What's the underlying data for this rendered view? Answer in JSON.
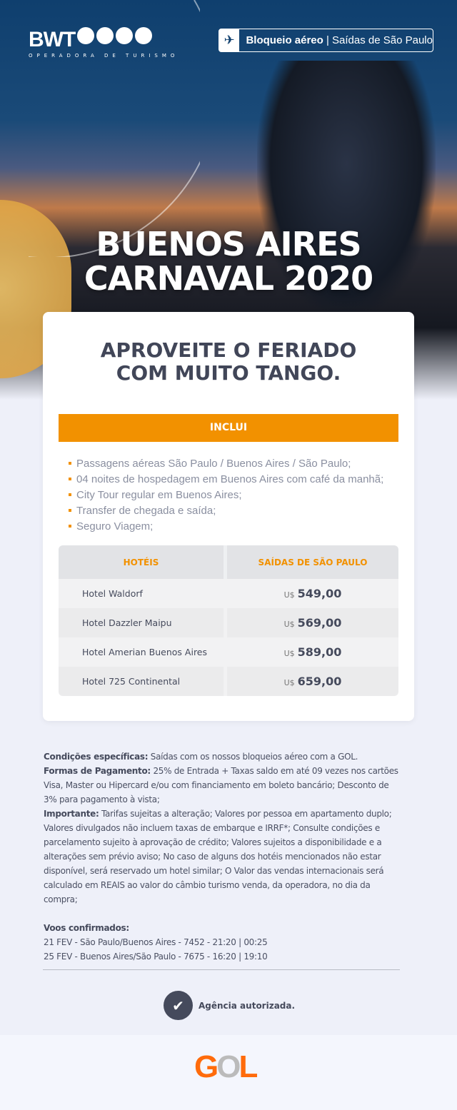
{
  "header": {
    "logo_text": "BWT",
    "logo_subtitle": "OPERADORA DE TURISMO",
    "badge_bold": "Bloqueio aéreo",
    "badge_sep": " | ",
    "badge_rest": "Saídas de São Paulo",
    "badge_icon": "airplane-icon"
  },
  "hero": {
    "title_line1": "BUENOS AIRES",
    "title_line2": "CARNAVAL 2020"
  },
  "card": {
    "headline_line1": "APROVEITE O FERIADO",
    "headline_line2": "COM MUITO TANGO.",
    "includes_label": "INCLUI",
    "includes": [
      "Passagens aéreas São Paulo / Buenos Aires / São Paulo;",
      "04 noites de hospedagem em Buenos Aires com café da manhã;",
      "City Tour regular em Buenos Aires;",
      "Transfer de chegada e saída;",
      "Seguro Viagem;"
    ],
    "table": {
      "headers": [
        "HOTÉIS",
        "SAÍDAS DE SÃO PAULO"
      ],
      "currency": "U$",
      "rows": [
        {
          "hotel": "Hotel Waldorf",
          "price": "549,00"
        },
        {
          "hotel": "Hotel Dazzler Maipu",
          "price": "569,00"
        },
        {
          "hotel": "Hotel Amerian Buenos Aires",
          "price": "589,00"
        },
        {
          "hotel": "Hotel 725 Continental",
          "price": "659,00"
        }
      ]
    }
  },
  "terms": {
    "cond_label": "Condições específicas:",
    "cond_text": " Saídas com os nossos bloqueios aéreo com a GOL.",
    "pay_label": "Formas de Pagamento:",
    "pay_text": " 25% de Entrada + Taxas saldo em até 09 vezes nos cartões Visa, Master ou Hipercard e/ou com financiamento em boleto bancário; Desconto de 3% para pagamento à vista;",
    "imp_label": "Importante:",
    "imp_text": " Tarifas sujeitas a alteração; Valores por pessoa em apartamento duplo; Valores divulgados não incluem taxas de embarque e IRRF*; Consulte condições e parcelamento sujeito à aprovação de crédito; Valores sujeitos a disponibilidade e a alterações sem prévio aviso; No caso de alguns dos hotéis mencionados não estar disponível, será reservado um hotel similar; O Valor das vendas internacionais será calculado em REAIS ao valor do câmbio turismo venda, da operadora, no dia da compra;",
    "flights_label": "Voos confirmados:",
    "flights": [
      "21 FEV - São Paulo/Buenos Aires - 7452 - 21:20 | 00:25",
      "25 FEV - Buenos Aires/São Paulo - 7675 - 16:20 | 19:10"
    ]
  },
  "footer": {
    "agency": "Agência autorizada.",
    "airline_logo": "GOL"
  },
  "colors": {
    "accent": "#f29100",
    "text": "#454a5c",
    "background": "#eef0f9"
  }
}
